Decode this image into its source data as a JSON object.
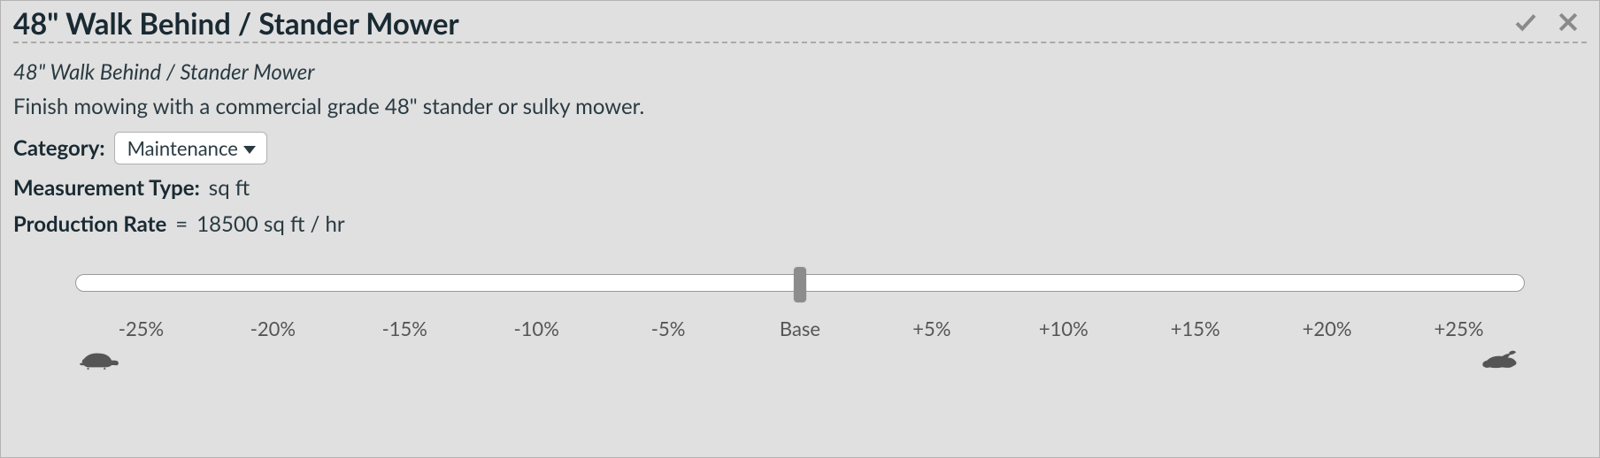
{
  "header": {
    "title": "48\" Walk Behind / Stander Mower"
  },
  "details": {
    "subtitle": "48\" Walk Behind / Stander Mower",
    "description": "Finish mowing with a commercial grade 48\" stander or sulky mower.",
    "category_label": "Category:",
    "category_value": "Maintenance",
    "measurement_label": "Measurement Type:",
    "measurement_value": "sq ft",
    "production_label": "Production Rate",
    "production_delim": " = ",
    "production_value": "18500 sq ft / hr"
  },
  "slider": {
    "ticks": [
      "-25%",
      "-20%",
      "-15%",
      "-10%",
      "-5%",
      "Base",
      "+5%",
      "+10%",
      "+15%",
      "+20%",
      "+25%"
    ],
    "value_index": 5
  },
  "icons": {
    "confirm": "check-icon",
    "cancel": "close-icon",
    "slow": "turtle-icon",
    "fast": "rabbit-icon"
  }
}
